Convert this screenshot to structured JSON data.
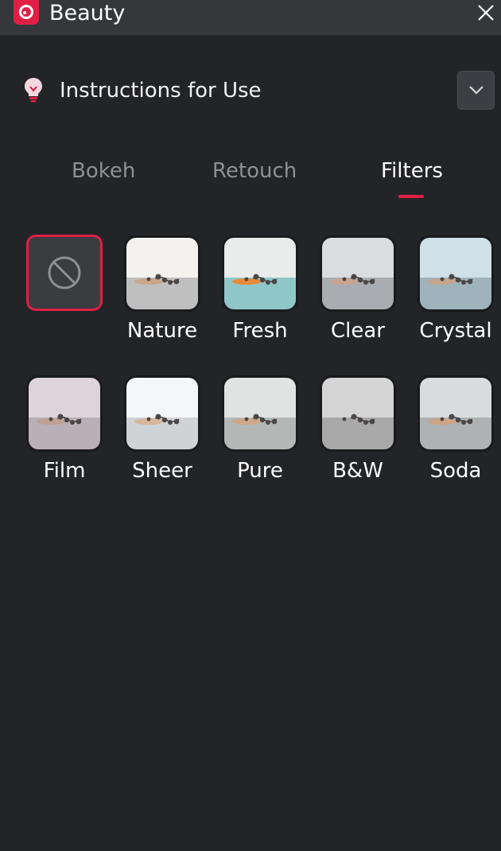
{
  "window": {
    "title": "Beauty",
    "logo_icon": "camera-lens-logo",
    "close_icon": "close-icon",
    "accent": "#e01f45"
  },
  "instructions": {
    "label": "Instructions for Use",
    "icon": "lightbulb-icon",
    "toggle_icon": "chevron-down-icon"
  },
  "tabs": [
    {
      "label": "Bokeh",
      "active": false
    },
    {
      "label": "Retouch",
      "active": false
    },
    {
      "label": "Filters",
      "active": true
    }
  ],
  "filters": {
    "selected": "none",
    "none_icon": "no-filter-icon",
    "items": [
      {
        "label": "Nature",
        "wall": "#f3f2ee",
        "table": "#bfbfbf",
        "tint": "#c9a88a"
      },
      {
        "label": "Fresh",
        "wall": "#e9eceb",
        "table": "#8fc7c9",
        "tint": "#e98a3a"
      },
      {
        "label": "Clear",
        "wall": "#d9dde0",
        "table": "#a9adb2",
        "tint": "#c9a492"
      },
      {
        "label": "Crystal",
        "wall": "#cfe0e8",
        "table": "#9fb3bd",
        "tint": "#c6a48c"
      },
      {
        "label": "Film",
        "wall": "#ddd3da",
        "table": "#b9b0b7",
        "tint": "#c1a092"
      },
      {
        "label": "Sheer",
        "wall": "#f4f7f8",
        "table": "#cfd3d6",
        "tint": "#d9b69a"
      },
      {
        "label": "Pure",
        "wall": "#dfe4e2",
        "table": "#b3b8b7",
        "tint": "#cfa78a"
      },
      {
        "label": "B&W",
        "wall": "#d4d4d4",
        "table": "#a8a8a8",
        "tint": "#a9a9a9"
      },
      {
        "label": "Soda",
        "wall": "#d8dcdd",
        "table": "#aeb2b3",
        "tint": "#cca486"
      }
    ]
  }
}
